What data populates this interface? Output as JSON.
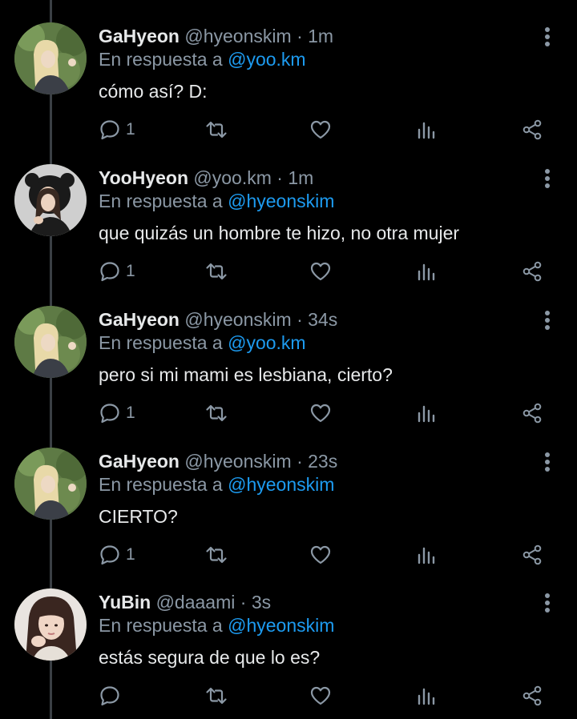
{
  "tweets": [
    {
      "name": "GaHyeon",
      "handle": "@hyeonskim",
      "dot": "·",
      "time": "1m",
      "reply_prefix": "En respuesta a",
      "reply_to": "@yoo.km",
      "text": "cómo así? D:",
      "reply_count": "1",
      "avatar": "gahyeon"
    },
    {
      "name": "YooHyeon",
      "handle": "@yoo.km",
      "dot": "·",
      "time": "1m",
      "reply_prefix": "En respuesta a",
      "reply_to": "@hyeonskim",
      "text": "que quizás un hombre te hizo, no otra mujer",
      "reply_count": "1",
      "avatar": "yoohyeon"
    },
    {
      "name": "GaHyeon",
      "handle": "@hyeonskim",
      "dot": "·",
      "time": "34s",
      "reply_prefix": "En respuesta a",
      "reply_to": "@yoo.km",
      "text": "pero si mi mami es lesbiana, cierto?",
      "reply_count": "1",
      "avatar": "gahyeon"
    },
    {
      "name": "GaHyeon",
      "handle": "@hyeonskim",
      "dot": "·",
      "time": "23s",
      "reply_prefix": "En respuesta a",
      "reply_to": "@hyeonskim",
      "text": "CIERTO?",
      "reply_count": "1",
      "avatar": "gahyeon"
    },
    {
      "name": "YuBin",
      "handle": "@daaami",
      "dot": "·",
      "time": "3s",
      "reply_prefix": "En respuesta a",
      "reply_to": "@hyeonskim",
      "text": "estás segura de que lo es?",
      "reply_count": "",
      "avatar": "yubin"
    }
  ],
  "icons": {
    "reply": "reply-icon",
    "retweet": "retweet-icon",
    "like": "heart-icon",
    "stats": "stats-icon",
    "share": "share-icon",
    "more": "more-vertical-icon"
  },
  "colors": {
    "background": "#000000",
    "name": "#e7e9ea",
    "secondary": "#8b98a5",
    "mention": "#1d9bf0",
    "thread_line": "#3a3f44"
  }
}
